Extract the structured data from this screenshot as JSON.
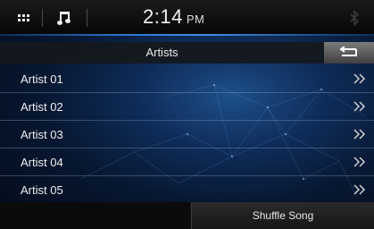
{
  "status_bar": {
    "apps_icon": "grid-icon",
    "music_icon": "music-note-icon",
    "time": "2:14",
    "ampm": "PM",
    "bluetooth_icon": "bluetooth-icon"
  },
  "header": {
    "title": "Artists",
    "back_icon": "return-arrow-icon"
  },
  "artists": [
    {
      "label": "Artist 01"
    },
    {
      "label": "Artist 02"
    },
    {
      "label": "Artist 03"
    },
    {
      "label": "Artist 04"
    },
    {
      "label": "Artist 05"
    }
  ],
  "footer": {
    "shuffle_label": "Shuffle Song"
  },
  "colors": {
    "accent": "#2a79d2",
    "background": "#0f2d5a"
  }
}
